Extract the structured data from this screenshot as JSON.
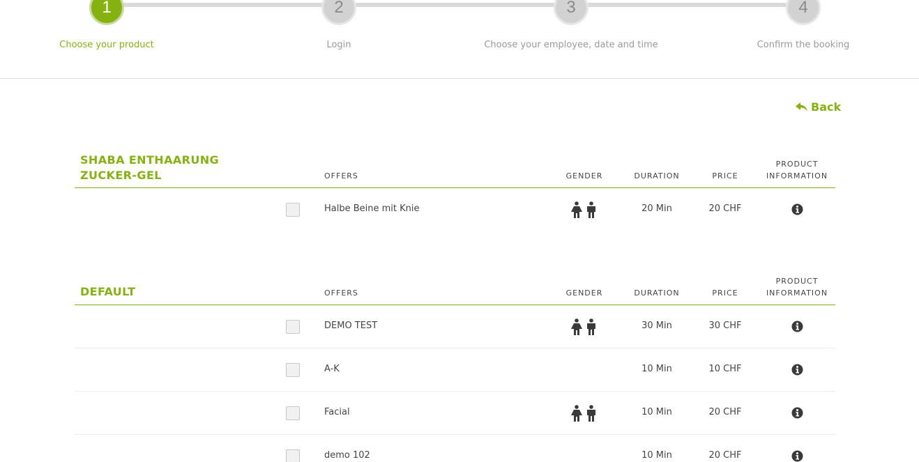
{
  "stepper": {
    "steps": [
      {
        "number": "1",
        "label": "Choose your product"
      },
      {
        "number": "2",
        "label": "Login"
      },
      {
        "number": "3",
        "label": "Choose your employee, date and time"
      },
      {
        "number": "4",
        "label": "Confirm the booking"
      }
    ],
    "active_step": "1"
  },
  "back_label": "Back",
  "columns": {
    "offers": "OFFERS",
    "gender": "GENDER",
    "duration": "DURATION",
    "price": "PRICE",
    "product_information_line1": "PRODUCT",
    "product_information_line2": "INFORMATION"
  },
  "categories": [
    {
      "title": "SHABA ENTHAARUNG ZUCKER-GEL",
      "offers": [
        {
          "name": "Halbe Beine mit Knie",
          "gender": "female-male-icons",
          "duration": "20 Min",
          "price": "20 CHF"
        }
      ]
    },
    {
      "title": "DEFAULT",
      "offers": [
        {
          "name": "DEMO TEST",
          "gender": "female-male-icons",
          "duration": "30 Min",
          "price": "30 CHF"
        },
        {
          "name": "A-K",
          "gender": "",
          "duration": "10 Min",
          "price": "10 CHF"
        },
        {
          "name": "Facial",
          "gender": "female-male-icons",
          "duration": "10 Min",
          "price": "20 CHF"
        },
        {
          "name": "demo 102",
          "gender": "",
          "duration": "10 Min",
          "price": "20 CHF"
        }
      ]
    }
  ],
  "colors": {
    "accent": "#85b20f",
    "inactive_step": "#d2d2d2",
    "text": "#444444"
  },
  "icons": [
    "back-arrow-icon",
    "female-icon",
    "male-icon",
    "info-icon"
  ]
}
